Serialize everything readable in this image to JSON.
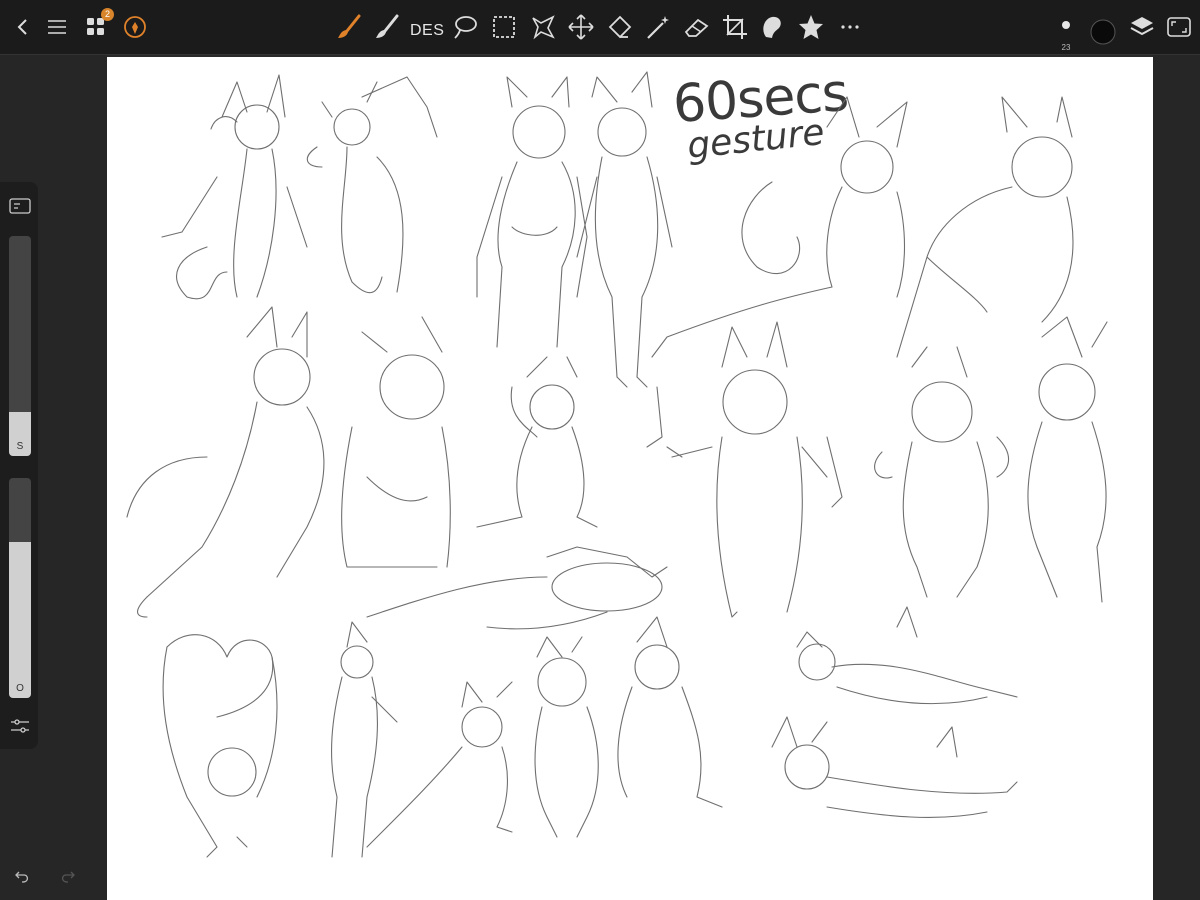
{
  "toolbar": {
    "back_icon": "chevron-left-icon",
    "menu_icon": "hamburger-icon",
    "gallery_icon": "grid-icon",
    "gallery_badge": "2",
    "carrot_icon": "carrot-icon",
    "tools": [
      "brush",
      "smudge",
      "DES",
      "lasso",
      "rect-select",
      "liquify",
      "move",
      "transform",
      "magic-wand",
      "eraser",
      "crop",
      "blob",
      "star",
      "more"
    ],
    "des_label": "DES",
    "brush_size": "23",
    "current_color": "#0a0a0a"
  },
  "sidebar": {
    "size_slider_label": "S",
    "size_slider_fill": 0.2,
    "opacity_slider_label": "O",
    "opacity_slider_fill": 0.71
  },
  "canvas": {
    "title": "60secs",
    "subtitle": "gesture"
  },
  "colors": {
    "accent": "#e0822a",
    "toolbar_bg": "#1b1b1b",
    "rail_bg": "#262626"
  }
}
